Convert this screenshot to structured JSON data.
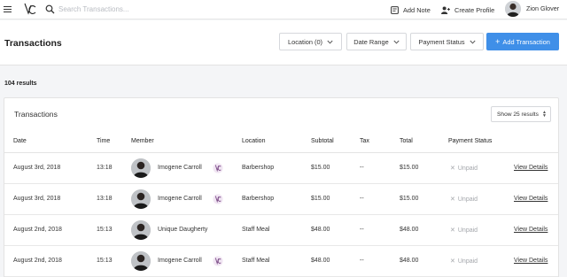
{
  "search": {
    "placeholder": "Search Transactions..."
  },
  "topbar": {
    "add_note": "Add Note",
    "create_profile": "Create Profile",
    "user_name": "Zion Glover"
  },
  "header": {
    "title": "Transactions",
    "filters": {
      "location": "Location (0)",
      "date_range": "Date Range",
      "payment_status": "Payment Status"
    },
    "add_button": "Add Transaction"
  },
  "results_count": "104 results",
  "card": {
    "title": "Transactions",
    "per_page": "Show 25 results",
    "columns": {
      "date": "Date",
      "time": "Time",
      "member": "Member",
      "location": "Location",
      "subtotal": "Subtotal",
      "tax": "Tax",
      "total": "Total",
      "payment_status": "Payment Status"
    },
    "rows": [
      {
        "date": "August 3rd, 2018",
        "time": "13:18",
        "member": "Imogene Carroll",
        "location": "Barbershop",
        "subtotal": "$15.00",
        "tax": "--",
        "total": "$15.00",
        "status": "Unpaid",
        "action": "View Details",
        "badge": true
      },
      {
        "date": "August 3rd, 2018",
        "time": "13:18",
        "member": "Imogene Carroll",
        "location": "Barbershop",
        "subtotal": "$15.00",
        "tax": "--",
        "total": "$15.00",
        "status": "Unpaid",
        "action": "View Details",
        "badge": true
      },
      {
        "date": "August 2nd, 2018",
        "time": "15:13",
        "member": "Unique Daugherty",
        "location": "Staff Meal",
        "subtotal": "$48.00",
        "tax": "--",
        "total": "$48.00",
        "status": "Unpaid",
        "action": "View Details",
        "badge": false
      },
      {
        "date": "August 2nd, 2018",
        "time": "15:13",
        "member": "Imogene Carroll",
        "location": "Staff Meal",
        "subtotal": "$48.00",
        "tax": "--",
        "total": "$48.00",
        "status": "Unpaid",
        "action": "View Details",
        "badge": true
      }
    ]
  },
  "colors": {
    "accent": "#3f8fe8",
    "unpaid": "#a3a6ab",
    "background": "#f4f5f7"
  }
}
